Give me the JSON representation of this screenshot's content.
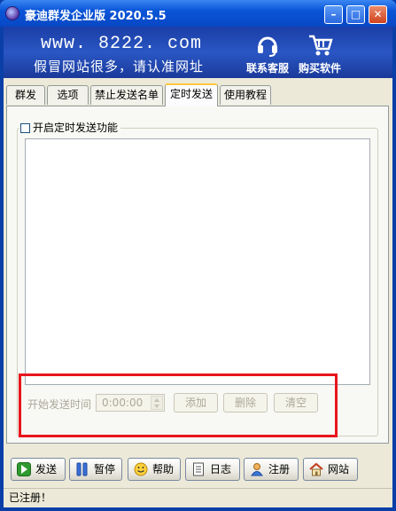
{
  "window": {
    "title": "豪迪群发企业版 2020.5.5"
  },
  "banner": {
    "url": "www. 8222. com",
    "slogan": "假冒网站很多，请认准网址",
    "links": [
      {
        "label": "联系客服",
        "icon": "headset-icon"
      },
      {
        "label": "购买软件",
        "icon": "shopping-cart-icon"
      }
    ]
  },
  "tabs": [
    {
      "label": "群发",
      "active": false
    },
    {
      "label": "选项",
      "active": false
    },
    {
      "label": "禁止发送名单",
      "active": false
    },
    {
      "label": "定时发送",
      "active": true
    },
    {
      "label": "使用教程",
      "active": false
    }
  ],
  "scheduled": {
    "enable_label": "开启定时发送功能",
    "enabled": false,
    "start_time_label": "开始发送时间",
    "start_time_value": "0:00:00",
    "add_label": "添加",
    "delete_label": "删除",
    "clear_label": "清空"
  },
  "toolbar": [
    {
      "label": "发送",
      "icon": "play-icon"
    },
    {
      "label": "暂停",
      "icon": "pause-icon"
    },
    {
      "label": "帮助",
      "icon": "smiley-icon"
    },
    {
      "label": "日志",
      "icon": "document-icon"
    },
    {
      "label": "注册",
      "icon": "user-icon"
    },
    {
      "label": "网站",
      "icon": "home-icon"
    }
  ],
  "status": {
    "text": "已注册！"
  },
  "colors": {
    "titlebar": "#0a55d8",
    "banner": "#2a56c4",
    "highlight": "#e8151c",
    "face": "#ece9d8"
  }
}
